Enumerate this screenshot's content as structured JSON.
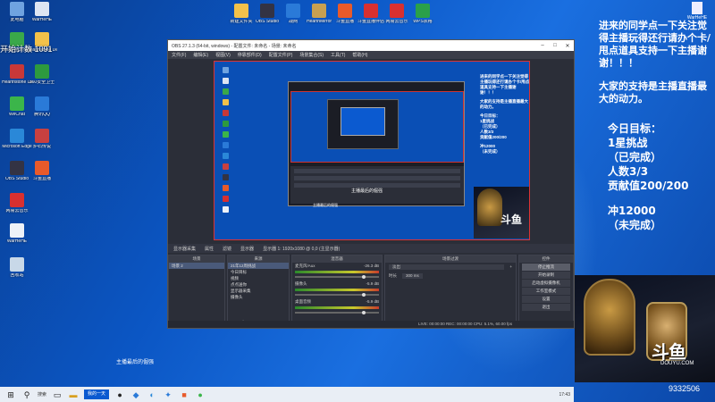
{
  "desktop": {
    "icons_left": [
      {
        "label": "此电脑",
        "color": "#6fa3e0"
      },
      {
        "label": "WarHeHE",
        "color": "#dde5f2"
      },
      {
        "label": "360安全浏览器",
        "color": "#3aa84a"
      },
      {
        "label": "Hearthstone Deck Tracker",
        "color": "#f2c14a"
      },
      {
        "label": "Hearthstone Deck Tracker",
        "color": "#c83838"
      },
      {
        "label": "360安全卫士",
        "color": "#2d9a3e"
      },
      {
        "label": "WeChat",
        "color": "#3bb54a"
      },
      {
        "label": "腾讯QQ",
        "color": "#2a7ad8"
      },
      {
        "label": "Microsoft Edge",
        "color": "#2a88d8"
      },
      {
        "label": "炉石传说",
        "color": "#c84040"
      },
      {
        "label": "OBS Studio",
        "color": "#333344"
      },
      {
        "label": "斗鱼直播",
        "color": "#e85a2a"
      },
      {
        "label": "网易云音乐",
        "color": "#d83030"
      },
      {
        "label": "WarHeHE",
        "color": "#eef2f8"
      },
      {
        "label": "回收站",
        "color": "#c8d8e8"
      }
    ],
    "icons_top": [
      {
        "label": "新建文件夹",
        "color": "#f2c14a"
      },
      {
        "label": "OBS Studio",
        "color": "#333344"
      },
      {
        "label": "战网",
        "color": "#2a7ad8"
      },
      {
        "label": "HearthMirror",
        "color": "#c8a050"
      },
      {
        "label": "斗鱼直播",
        "color": "#e85a2a"
      },
      {
        "label": "斗鱼直播伴侣",
        "color": "#d83030"
      },
      {
        "label": "网易云音乐",
        "color": "#d83030"
      },
      {
        "label": "WPS表格",
        "color": "#2aa04a"
      }
    ],
    "counter_text": "开始计数 1091",
    "caption": "主播最后的倔强",
    "corner_file": "WarHeHE"
  },
  "overlay": {
    "note": "进来的同学点一下关注觉得主播玩得还行请办个卡/甩点道具支持一下主播谢谢！！！",
    "support": "大家的支持是主播直播最大的动力。",
    "goal_title": "今日目标：",
    "goal_1": "1星挑战",
    "goal_1_status": "（已完成）",
    "goal_2": "人数3/3",
    "goal_3": "贡献值200/200",
    "goal_4": "冲12000",
    "goal_4_status": "（未完成）",
    "logo": "斗鱼",
    "domain": "DOUYU.COM",
    "room_id": "9332506"
  },
  "obs": {
    "title": "OBS 27.1.3 (64-bit, windows) - 配置文件: 未命名 - 场景: 未命名",
    "menu": [
      "文件(F)",
      "编辑(E)",
      "视图(V)",
      "停靠部件(D)",
      "配置文件(P)",
      "场景集合(S)",
      "工具(T)",
      "帮助(H)"
    ],
    "preview_caption": "主播最后的倔强",
    "nested_text": "主播最后的倔强",
    "toolbar": [
      "显示器采集",
      "属性",
      "滤镜",
      "显示器",
      "显示器 1: 1920x1080 @ 0,0 (主显示器)"
    ],
    "docks": {
      "scenes": {
        "header": "场景",
        "items": [
          "场景 2"
        ]
      },
      "sources": {
        "header": "来源",
        "items": [
          "21年12周挑战",
          "今日目标",
          "视频",
          "点点送你",
          "显示器采集",
          "摄像头"
        ]
      },
      "mixer": {
        "header": "混音器",
        "channels": [
          {
            "name": "麦克风/Aux",
            "db": "-26.3 dB"
          },
          {
            "name": "摄像头",
            "db": "-5.9 dB"
          },
          {
            "name": "桌面音频",
            "db": "-5.9 dB"
          }
        ]
      },
      "transitions": {
        "header": "场景过渡",
        "type": "淡出",
        "duration_label": "时长",
        "duration": "300 ms"
      },
      "controls": {
        "header": "控件",
        "buttons": [
          "停止推流",
          "开始录制",
          "启动虚拟摄像机",
          "工作室模式",
          "设置",
          "退出"
        ]
      }
    },
    "statusbar": "LIVE: 00:00:00   REC: 00:00:00   CPU: 5.1%, 60.00 fps"
  },
  "taskbar": {
    "search_label": "搜索",
    "active_app": "我的一天",
    "tray": "17:43"
  }
}
